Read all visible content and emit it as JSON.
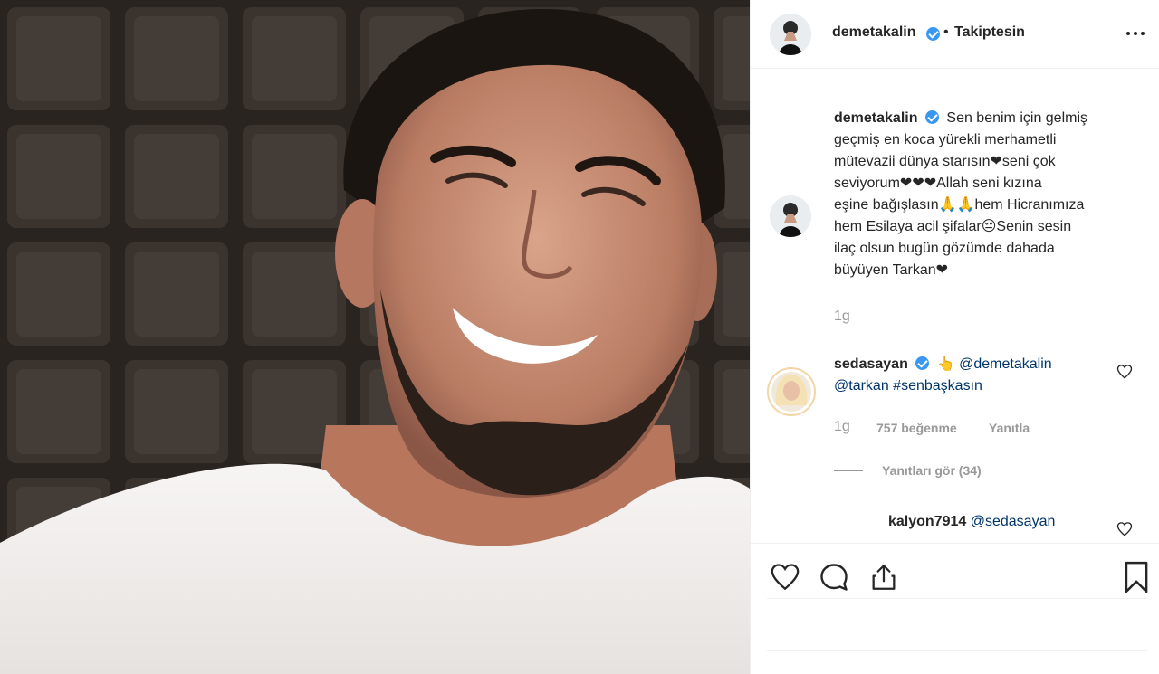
{
  "post": {
    "author": "demetakalin",
    "follow_status": "Takiptesin",
    "separator": "•"
  },
  "caption": {
    "username": "demetakalin",
    "lines": [
      "Sen benim için gelmiş",
      "geçmiş en koca yürekli merhametli",
      "mütevazii dünya starısın❤seni çok",
      "seviyorum❤❤❤Allah seni kızına",
      "eşine bağışlasın🙏🙏hem Hicranımıza",
      "hem Esilaya acil şifalar😔Senin sesin",
      "ilaç olsun bugün gözümde dahada",
      "büyüyen Tarkan❤"
    ],
    "time": "1g"
  },
  "comment": {
    "username": "sedasayan",
    "emoji": "👆",
    "mention1": "@demetakalin",
    "mention2": "@tarkan",
    "hashtag": "#senbaşkasın",
    "time": "1g",
    "likes": "757 beğenme",
    "reply_label": "Yanıtla",
    "view_replies": "Yanıtları gör (34)"
  },
  "reply": {
    "username": "kalyon7914",
    "mention": "@sedasayan"
  },
  "icons": {
    "like": "heart-icon",
    "comment": "comment-icon",
    "share": "share-icon",
    "save": "bookmark-icon",
    "more": "more-dots-icon",
    "verified": "verified-badge-icon"
  },
  "colors": {
    "verified": "#3897f0",
    "mention": "#003569",
    "muted": "#999999",
    "text": "#262626"
  }
}
